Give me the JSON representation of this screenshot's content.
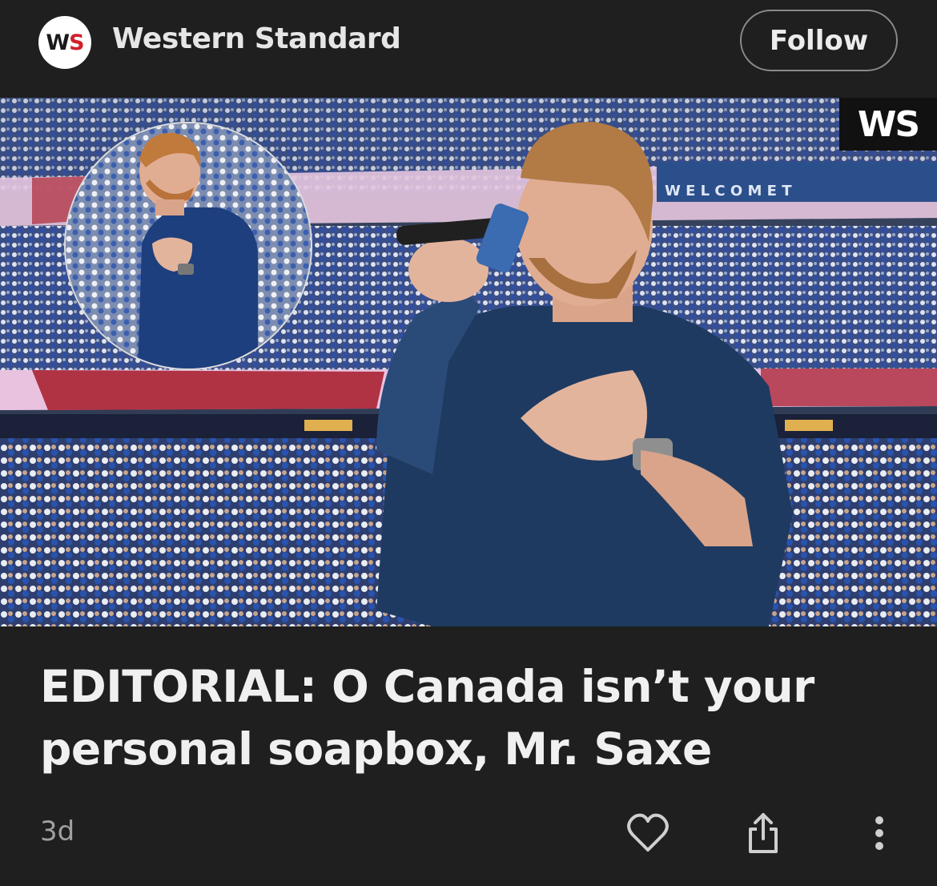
{
  "header": {
    "logo_text_w": "W",
    "logo_text_s": "S",
    "publisher_name": "Western Standard",
    "follow_label": "Follow"
  },
  "hero": {
    "badge_text": "WS",
    "banner_text": "W E L C O M E   T"
  },
  "article": {
    "headline": "EDITORIAL: O Canada isn’t your personal soapbox, Mr. Saxe",
    "age": "3d"
  },
  "actions": {
    "like_icon": "heart-icon",
    "share_icon": "share-icon",
    "more_icon": "more-vertical-icon"
  },
  "colors": {
    "background": "#1f1f1f",
    "logo_red": "#d0202a",
    "follow_border": "#8a8a8a"
  }
}
